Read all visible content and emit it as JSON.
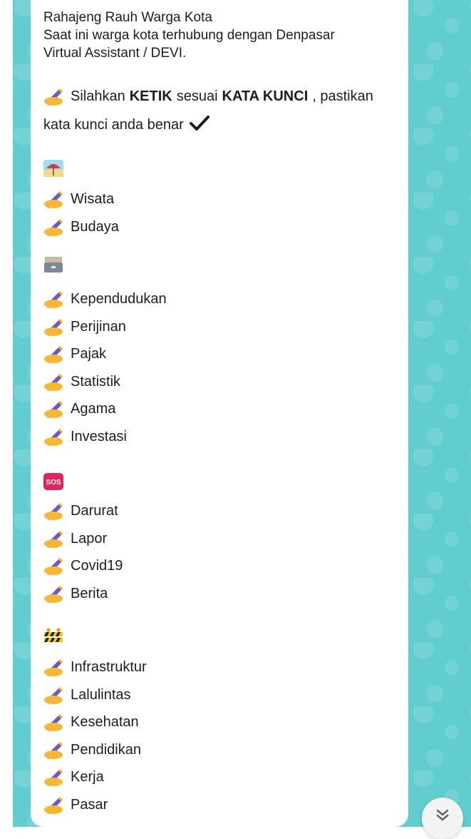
{
  "header": {
    "line1": "Rahajeng Rauh Warga Kota",
    "line2": "Saat ini warga kota terhubung dengan Denpasar",
    "line3": "Virtual Assistant / DEVI."
  },
  "instruction": {
    "part1": "Silahkan",
    "keyword1": "KETIK",
    "part2": "sesuai",
    "keyword2": "KATA KUNCI",
    "part3": ", pastikan",
    "line2": "kata kunci anda benar"
  },
  "groups": [
    {
      "icon": "beach-umbrella-icon",
      "items": [
        "Wisata",
        "Budaya"
      ]
    },
    {
      "icon": "card-file-box-icon",
      "items": [
        "Kependudukan",
        "Perijinan",
        "Pajak",
        "Statistik",
        "Agama",
        "Investasi"
      ]
    },
    {
      "icon": "sos-icon",
      "icon_text": "SOS",
      "items": [
        "Darurat",
        "Lapor",
        "Covid19",
        "Berita"
      ]
    },
    {
      "icon": "construction-icon",
      "items": [
        "Infrastruktur",
        "Lalulintas",
        "Kesehatan",
        "Pendidikan",
        "Kerja",
        "Pasar"
      ]
    }
  ],
  "colors": {
    "wallpaper": "#62cdcf",
    "bubble": "#ffffff",
    "text": "#1d1d1d",
    "sos_badge": "#e0245e"
  }
}
